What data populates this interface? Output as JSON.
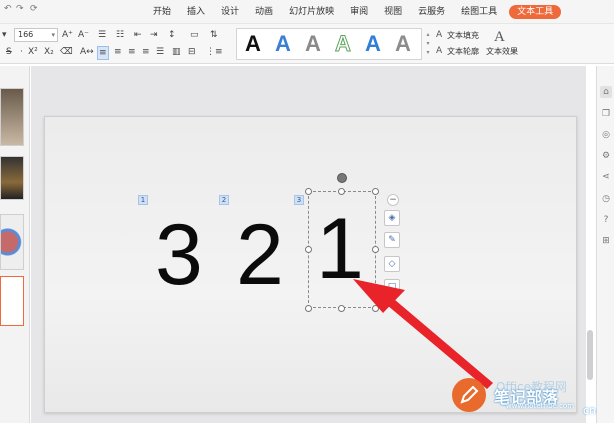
{
  "menu": {
    "tabs": [
      {
        "label": "开始"
      },
      {
        "label": "插入"
      },
      {
        "label": "设计"
      },
      {
        "label": "动画"
      },
      {
        "label": "幻灯片放映"
      },
      {
        "label": "审阅"
      },
      {
        "label": "视图"
      },
      {
        "label": "云服务"
      },
      {
        "label": "绘图工具"
      },
      {
        "label": "文本工具",
        "active": true
      }
    ]
  },
  "ribbon": {
    "font_size": "166",
    "text_fill": "文本填充",
    "text_outline": "文本轮廓",
    "text_effect": "文本效果",
    "wordart_colors": [
      "#111111",
      "#3b7fd4",
      "#8a8a8a",
      "#5aa35a",
      "#2f7fd8",
      "#8c8c8c"
    ]
  },
  "slide": {
    "numbers": [
      {
        "text": "3",
        "marker": "1"
      },
      {
        "text": "2",
        "marker": "2"
      },
      {
        "text": "1",
        "marker": "3"
      }
    ]
  },
  "floating_toolbar": [
    "minus-icon",
    "layers-icon",
    "pen-icon",
    "fill-icon",
    "outline-icon"
  ],
  "right_panel_icons": [
    "home-icon",
    "copy-icon",
    "shapes-icon",
    "settings-icon",
    "share-icon",
    "history-icon",
    "help-icon",
    "grid-icon"
  ],
  "watermark": {
    "title": "笔记部落",
    "url": "www.notetribe.com",
    "cn": "cn",
    "faint": "Office教程网"
  },
  "colors": {
    "accent": "#ef6a3a",
    "selection": "#d6e6fa",
    "arrow": "#e8232a"
  }
}
